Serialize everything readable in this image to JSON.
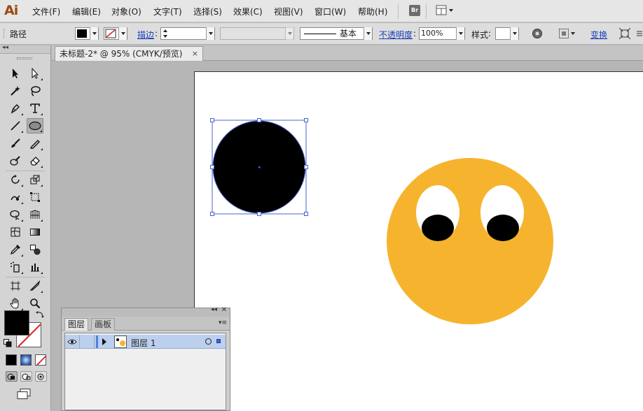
{
  "app": {
    "logo": "Ai"
  },
  "menu": {
    "items": [
      "文件(F)",
      "编辑(E)",
      "对象(O)",
      "文字(T)",
      "选择(S)",
      "效果(C)",
      "视图(V)",
      "窗口(W)",
      "帮助(H)"
    ],
    "bridge_label": "Br"
  },
  "control_bar": {
    "selection_type": "路径",
    "stroke_label": "描边",
    "brush_style": "基本",
    "opacity_label": "不透明度",
    "opacity_value": "100%",
    "style_label": "样式",
    "transform_label": "变换"
  },
  "document": {
    "tab_title": "未标题-2* @ 95% (CMYK/预览)",
    "close_glyph": "×"
  },
  "artwork": {
    "selected_circle_fill": "#000000",
    "selection_color": "#4a64c8",
    "face_fill": "#f6b42e",
    "eye_white": "#ffffff",
    "pupil_fill": "#000000"
  },
  "toolbox": {
    "tools": [
      "selection-tool",
      "direct-selection-tool",
      "magic-wand-tool",
      "lasso-tool",
      "pen-tool",
      "type-tool",
      "line-segment-tool",
      "ellipse-tool",
      "paintbrush-tool",
      "pencil-tool",
      "blob-brush-tool",
      "eraser-tool",
      "rotate-tool",
      "scale-tool",
      "warp-tool",
      "free-transform-tool",
      "shape-builder-tool",
      "perspective-grid-tool",
      "mesh-tool",
      "gradient-tool",
      "eyedropper-tool",
      "blend-tool",
      "symbol-sprayer-tool",
      "column-graph-tool",
      "artboard-tool",
      "slice-tool",
      "hand-tool",
      "zoom-tool"
    ],
    "active_tool": "ellipse-tool",
    "fill_color": "#000000"
  },
  "layers_panel": {
    "tabs": [
      "图层",
      "画板"
    ],
    "active_tab": "图层",
    "layers": [
      {
        "name": "图层 1",
        "color": "#4f7fe0"
      }
    ]
  }
}
